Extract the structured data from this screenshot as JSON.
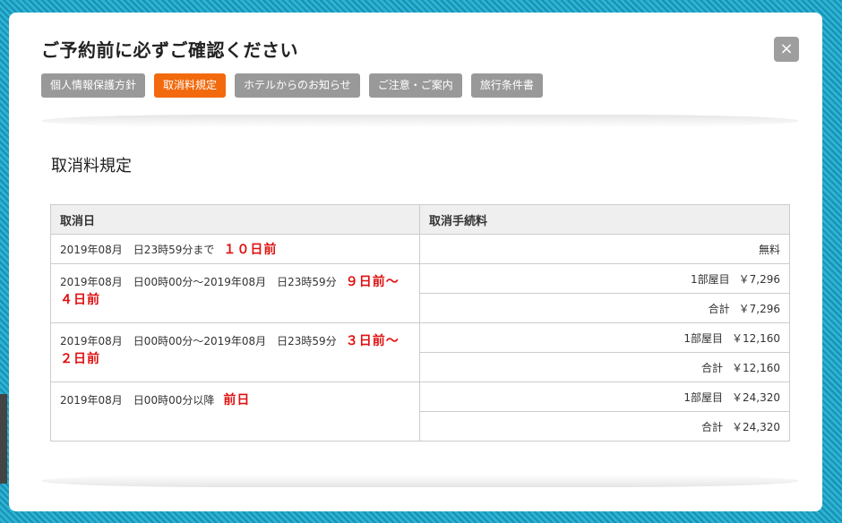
{
  "modal": {
    "title": "ご予約前に必ずご確認ください",
    "close_label": "×"
  },
  "tabs": [
    {
      "label": "個人情報保護方針",
      "active": false
    },
    {
      "label": "取消料規定",
      "active": true
    },
    {
      "label": "ホテルからのお知らせ",
      "active": false
    },
    {
      "label": "ご注意・ご案内",
      "active": false
    },
    {
      "label": "旅行条件書",
      "active": false
    }
  ],
  "section": {
    "title": "取消料規定"
  },
  "table": {
    "headers": [
      "取消日",
      "取消手続料"
    ],
    "rows": [
      {
        "date": "2019年08月　日23時59分まで",
        "label": "１０日前",
        "fee_free": "無料"
      },
      {
        "date": "2019年08月　日00時00分～2019年08月　日23時59分",
        "label": "９日前～４日前",
        "per_room_label": "1部屋目",
        "per_room_amount": "￥7,296",
        "total_label": "合計",
        "total_amount": "￥7,296"
      },
      {
        "date": "2019年08月　日00時00分～2019年08月　日23時59分",
        "label": "３日前～２日前",
        "per_room_label": "1部屋目",
        "per_room_amount": "￥12,160",
        "total_label": "合計",
        "total_amount": "￥12,160"
      },
      {
        "date": "2019年08月　日00時00分以降",
        "label": "前日",
        "per_room_label": "1部屋目",
        "per_room_amount": "￥24,320",
        "total_label": "合計",
        "total_amount": "￥24,320"
      }
    ]
  },
  "colors": {
    "accent": "#f26a0d",
    "tab_inactive": "#999999",
    "label_red": "#e01010",
    "frame": "#1e9fc0"
  }
}
